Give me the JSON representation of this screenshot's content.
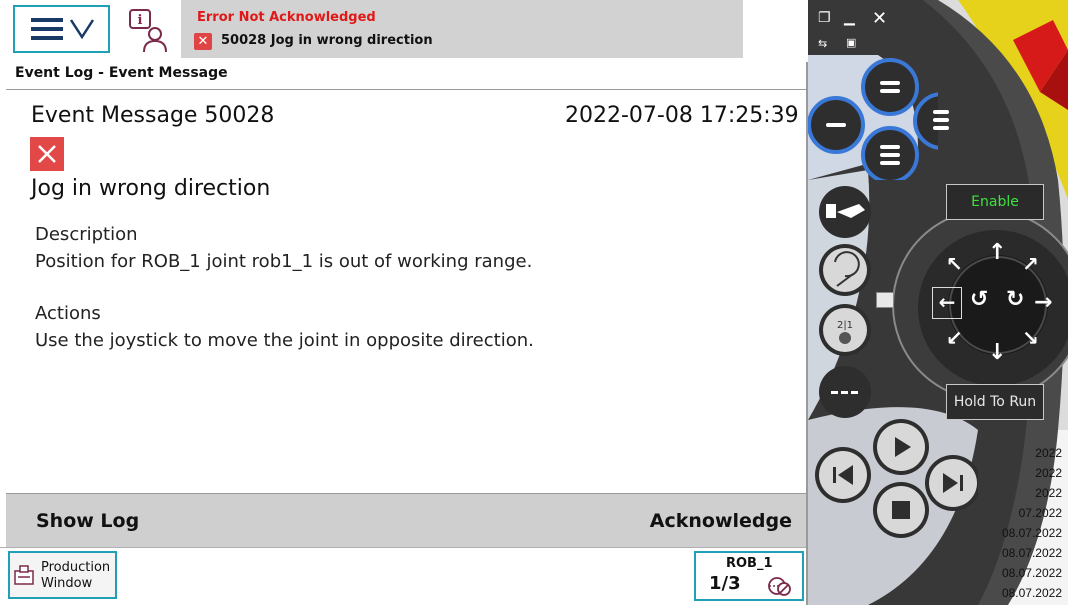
{
  "status": {
    "title": "Error Not Acknowledged",
    "message": "50028 Jog in wrong direction"
  },
  "breadcrumb": "Event Log - Event Message",
  "event": {
    "title": "Event Message 50028",
    "timestamp": "2022-07-08 17:25:39",
    "subject": "Jog in wrong direction",
    "description_heading": "Description",
    "description": "Position for ROB_1 joint rob1_1 is out of working range.",
    "actions_heading": "Actions",
    "actions": "Use the joystick to move the joint in opposite direction."
  },
  "buttons": {
    "show_log": "Show Log",
    "acknowledge": "Acknowledge"
  },
  "taskbar": {
    "production_window_line1": "Production",
    "production_window_line2": "Window",
    "robot": "ROB_1",
    "speed_fraction": "1/3"
  },
  "pendant": {
    "enable": "Enable",
    "hold_to_run": "Hold To Run"
  },
  "log_dates": [
    "2022",
    "2022",
    "2022",
    "07.2022",
    "08.07.2022",
    "08.07.2022",
    "08.07.2022",
    "08.07.2022"
  ],
  "colors": {
    "accent": "#1fa0b4",
    "error": "#e24848",
    "status_text": "#e01818",
    "pendant_blue": "#3a78d8",
    "enable_text": "#3ee03e"
  }
}
